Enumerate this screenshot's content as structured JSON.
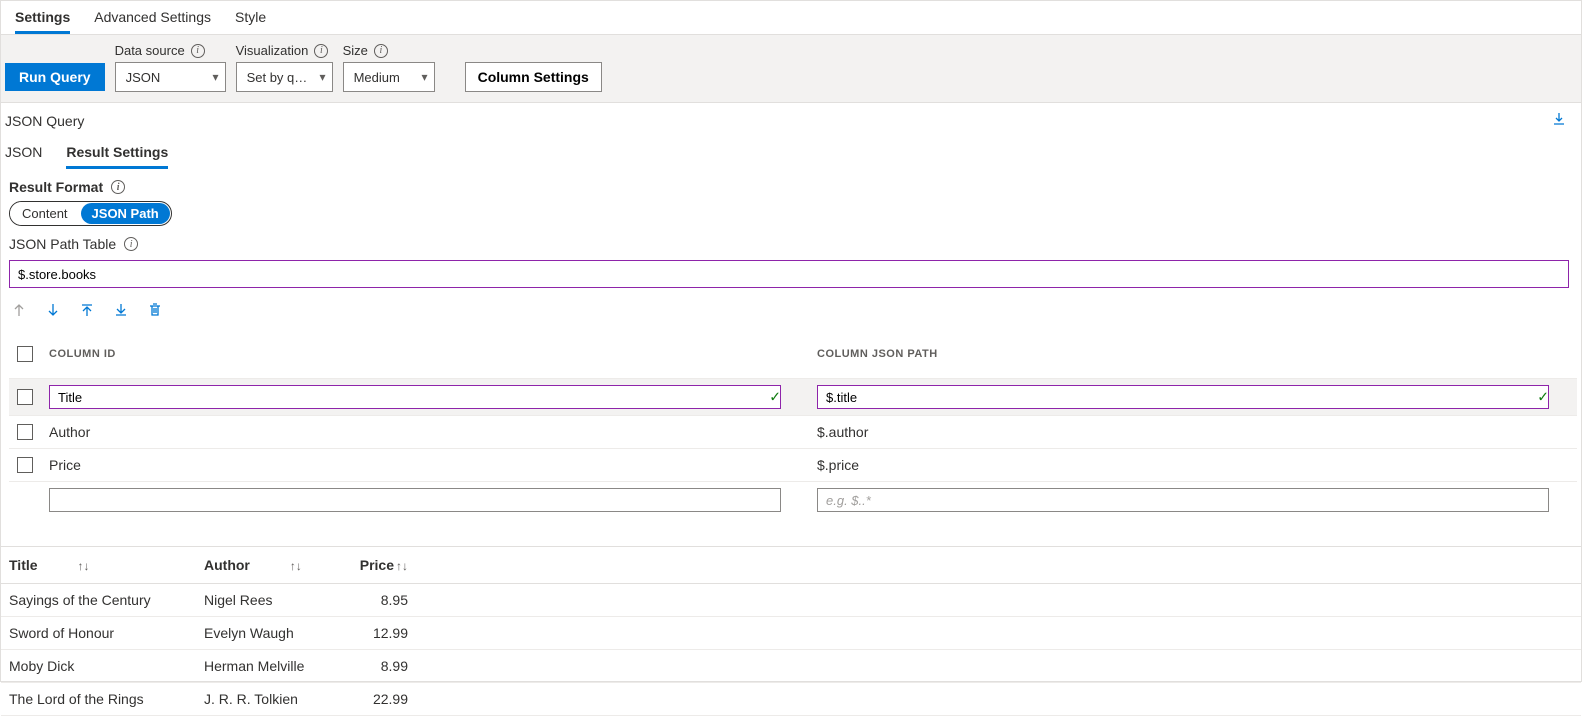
{
  "tabs": {
    "settings": "Settings",
    "advanced": "Advanced Settings",
    "style": "Style"
  },
  "toolbar": {
    "run_query": "Run Query",
    "data_source_label": "Data source",
    "data_source_value": "JSON",
    "visualization_label": "Visualization",
    "visualization_value": "Set by q…",
    "size_label": "Size",
    "size_value": "Medium",
    "column_settings": "Column Settings"
  },
  "section_title": "JSON Query",
  "subtabs": {
    "json": "JSON",
    "result_settings": "Result Settings"
  },
  "result_format": {
    "label": "Result Format",
    "content": "Content",
    "json_path": "JSON Path"
  },
  "json_path_table": {
    "label": "JSON Path Table",
    "value": "$.store.books"
  },
  "columns": {
    "header_id": "Column ID",
    "header_path": "Column JSON Path",
    "rows": [
      {
        "id": "Title",
        "path": "$.title",
        "active": true
      },
      {
        "id": "Author",
        "path": "$.author",
        "active": false
      },
      {
        "id": "Price",
        "path": "$.price",
        "active": false
      }
    ],
    "new_row_placeholder": "e.g. $..*"
  },
  "results": {
    "headers": {
      "title": "Title",
      "author": "Author",
      "price": "Price"
    },
    "rows": [
      {
        "title": "Sayings of the Century",
        "author": "Nigel Rees",
        "price": "8.95"
      },
      {
        "title": "Sword of Honour",
        "author": "Evelyn Waugh",
        "price": "12.99"
      },
      {
        "title": "Moby Dick",
        "author": "Herman Melville",
        "price": "8.99"
      },
      {
        "title": "The Lord of the Rings",
        "author": "J. R. R. Tolkien",
        "price": "22.99"
      }
    ]
  }
}
